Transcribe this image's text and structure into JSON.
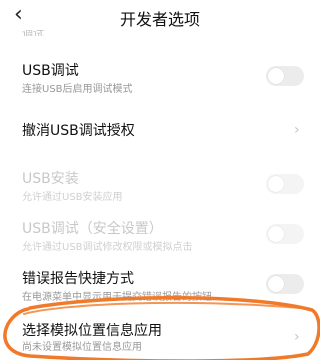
{
  "header": {
    "title": "开发者选项",
    "back_icon": "‹",
    "partial_text": "调试"
  },
  "rows": [
    {
      "title": "USB调试",
      "subtitle": "连接USB后启用调试模式",
      "control": "toggle",
      "enabled": true,
      "checked": false
    },
    {
      "title": "撤消USB调试授权",
      "subtitle": "",
      "control": "chevron",
      "enabled": true
    },
    {
      "title": "USB安装",
      "subtitle": "允许通过USB安装应用",
      "control": "toggle",
      "enabled": false,
      "checked": false
    },
    {
      "title": "USB调试（安全设置）",
      "subtitle": "允许通过USB调试修改权限或模拟点击",
      "control": "toggle",
      "enabled": false,
      "checked": false
    },
    {
      "title": "错误报告快捷方式",
      "subtitle": "在电源菜单中显示用于提交错误报告的按钮",
      "control": "toggle",
      "enabled": true,
      "checked": false
    },
    {
      "title": "选择模拟位置信息应用",
      "subtitle": "尚未设置模拟位置信息应用",
      "control": "chevron",
      "enabled": true
    }
  ],
  "icons": {
    "chevron": "chevron-right-icon",
    "back": "back-arrow-icon"
  },
  "colors": {
    "annotation": "#F07A2A",
    "toggle_off": "#ECECEC"
  }
}
